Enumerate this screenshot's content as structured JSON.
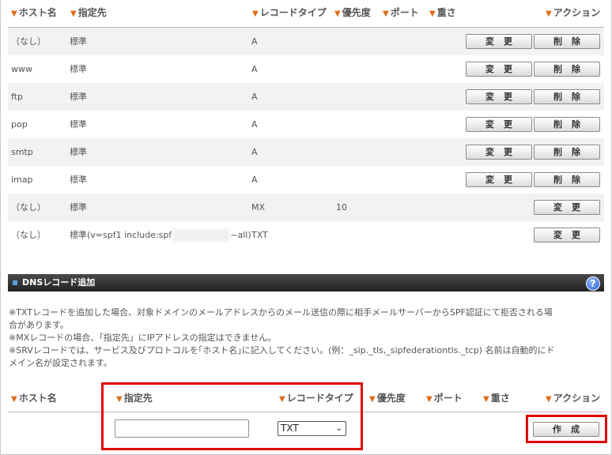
{
  "table": {
    "headers": {
      "host": "ホスト名",
      "dest": "指定先",
      "type": "レコードタイプ",
      "prio": "優先度",
      "port": "ポート",
      "weight": "重さ",
      "action": "アクション"
    },
    "rows": [
      {
        "host": "（なし）",
        "dest": "標準",
        "type": "A",
        "prio": ""
      },
      {
        "host": "www",
        "dest": "標準",
        "type": "A",
        "prio": ""
      },
      {
        "host": "ftp",
        "dest": "標準",
        "type": "A",
        "prio": ""
      },
      {
        "host": "pop",
        "dest": "標準",
        "type": "A",
        "prio": ""
      },
      {
        "host": "smtp",
        "dest": "標準",
        "type": "A",
        "prio": ""
      },
      {
        "host": "imap",
        "dest": "標準",
        "type": "A",
        "prio": ""
      },
      {
        "host": "（なし）",
        "dest": "標準",
        "type": "MX",
        "prio": "10"
      },
      {
        "host": "（なし）",
        "dest_prefix": "標準(v=spf1 include:spf",
        "dest_suffix": "~all)",
        "type": "TXT",
        "prio": ""
      }
    ],
    "edit_label": "変更",
    "delete_label": "削除"
  },
  "section": {
    "title": "DNSレコード追加",
    "help_label": "?"
  },
  "notes": [
    "※TXTレコードを追加した場合、対象ドメインのメールアドレスからのメール送信の際に相手メールサーバーからSPF認証にて拒否される場",
    "合があります。",
    "※MXレコードの場合、「指定先」にIPアドレスの指定はできません。",
    "※SRVレコードでは、サービス及びプロトコルを｢ホスト名｣に記入してください。(例：_sip._tls,_sipfederationtls._tcp) 名前は自動的にド",
    "メイン名が設定されます。"
  ],
  "add_form": {
    "headers": {
      "host": "ホスト名",
      "dest": "指定先",
      "type": "レコードタイプ",
      "prio": "優先度",
      "port": "ポート",
      "weight": "重さ",
      "action": "アクション"
    },
    "dest_value": "",
    "type_selected": "TXT",
    "create_label": "作成"
  },
  "colors": {
    "triangle": "#e06b1a",
    "highlight_box": "#e00000",
    "row_shade": "#f2f2f2"
  }
}
